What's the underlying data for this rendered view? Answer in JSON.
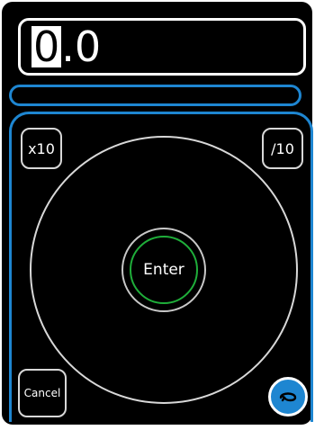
{
  "display": {
    "value_first_char": "0",
    "value_rest": ".0"
  },
  "buttons": {
    "multiply_label": "x10",
    "divide_label": "/10",
    "enter_label": "Enter",
    "cancel_label": "Cancel",
    "dial_action_icon": "loop-arrow-icon"
  },
  "colors": {
    "background": "#000000",
    "accent": "#1e86d1",
    "enter_ring": "#1fae3a",
    "text": "#ffffff"
  }
}
